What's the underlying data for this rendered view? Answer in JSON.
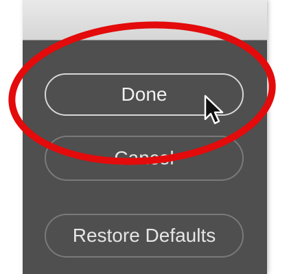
{
  "dialog": {
    "done_label": "Done",
    "cancel_label": "Cancel",
    "restore_label": "Restore Defaults"
  },
  "colors": {
    "panel_background": "#4f4f4f",
    "button_border": "#7a7a7a",
    "button_border_focused": "#d8d8d8",
    "button_text": "#e6e6e6",
    "annotation_red": "#e30b0b"
  },
  "icons": {
    "cursor": "mouse-pointer-arrow-icon"
  }
}
